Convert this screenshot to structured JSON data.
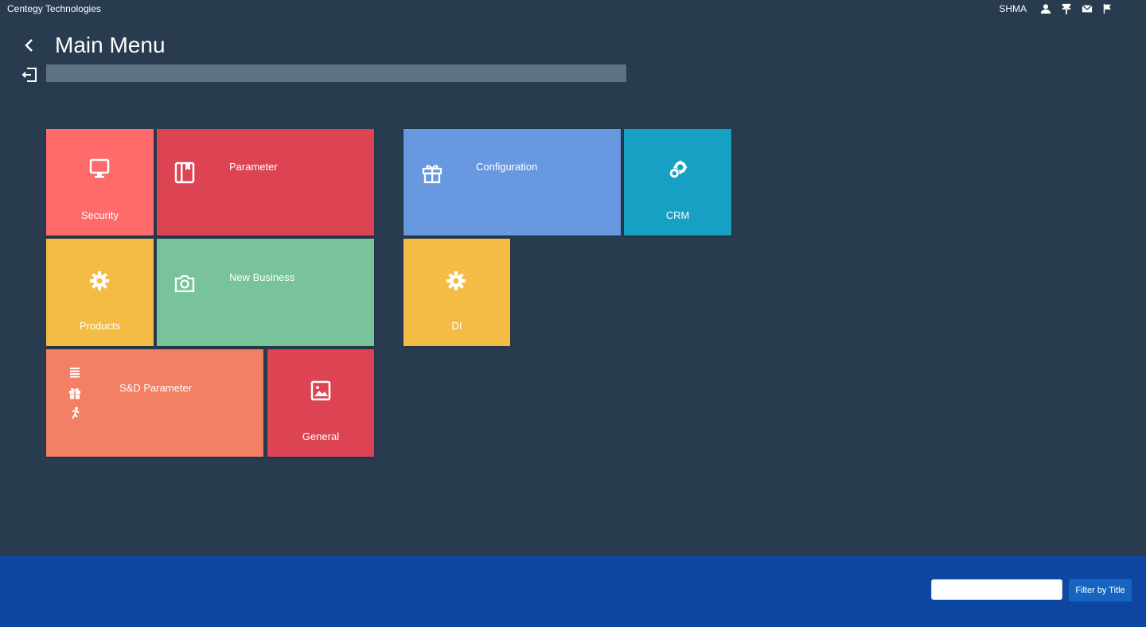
{
  "header": {
    "company": "Centegy Technologies",
    "user": "SHMA",
    "icons": [
      "user-icon",
      "pin-icon",
      "mail-icon",
      "flag-icon"
    ]
  },
  "page": {
    "title": "Main Menu",
    "search_value": ""
  },
  "tiles": [
    {
      "key": "security",
      "label": "Security",
      "color": "#ff6b6b",
      "icon": "monitor-icon"
    },
    {
      "key": "parameter",
      "label": "Parameter",
      "color": "#dc4454",
      "icon": "book-icon"
    },
    {
      "key": "configuration",
      "label": "Configuration",
      "color": "#6899e0",
      "icon": "gift-icon"
    },
    {
      "key": "crm",
      "label": "CRM",
      "color": "#15a0c4",
      "icon": "gears-icon"
    },
    {
      "key": "products",
      "label": "Products",
      "color": "#f4bc45",
      "icon": "gear-icon"
    },
    {
      "key": "new-business",
      "label": "New Business",
      "color": "#78c399",
      "icon": "camera-icon"
    },
    {
      "key": "di",
      "label": "DI",
      "color": "#f4bc45",
      "icon": "gear-icon"
    },
    {
      "key": "sd-parameter",
      "label": "S&D Parameter",
      "color": "#f37f65",
      "icon": "list-gift-run-icons"
    },
    {
      "key": "general",
      "label": "General",
      "color": "#dc4454",
      "icon": "image-icon"
    }
  ],
  "footer": {
    "filter_placeholder": "",
    "filter_button_label": "Filter by Title",
    "color": "#0d47a1"
  }
}
